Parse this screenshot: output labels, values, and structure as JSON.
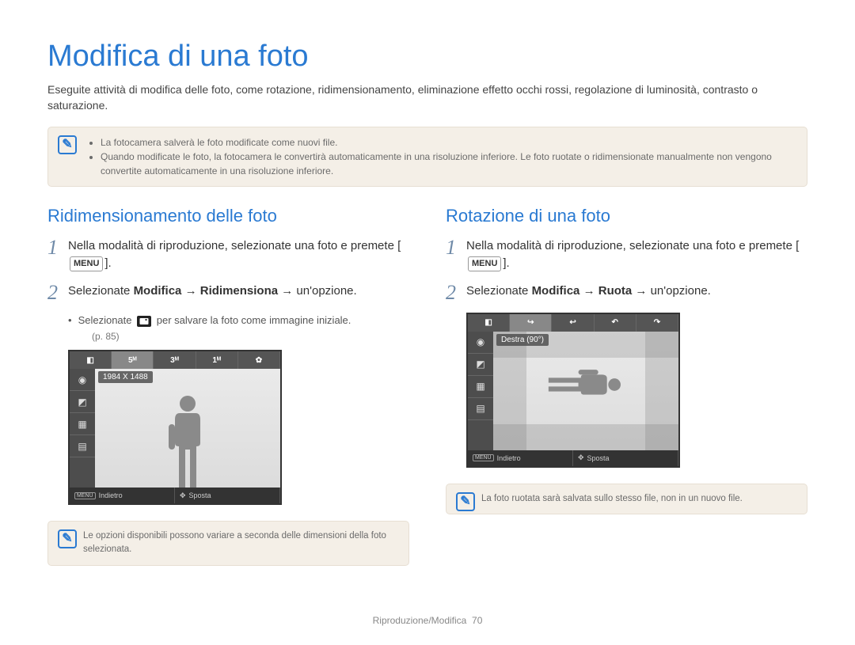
{
  "page": {
    "title": "Modifica di una foto",
    "intro": "Eseguite attività di modifica delle foto, come rotazione, ridimensionamento, eliminazione effetto occhi rossi, regolazione di luminosità, contrasto o saturazione.",
    "footer_section": "Riproduzione/Modifica",
    "footer_page": "70"
  },
  "top_note": {
    "items": [
      "La fotocamera salverà le foto modificate come nuovi file.",
      "Quando modificate le foto, la fotocamera le convertirà automaticamente in una risoluzione inferiore. Le foto ruotate o ridimensionate manualmente non vengono convertite automaticamente in una risoluzione inferiore."
    ]
  },
  "left": {
    "heading": "Ridimensionamento delle foto",
    "step1_a": "Nella modalità di riproduzione, selezionate una foto e premete [",
    "menu_label": "MENU",
    "step1_b": "].",
    "step2_a": "Selezionate ",
    "step2_bold": "Modifica → Ridimensiona",
    "step2_b": " → un'opzione.",
    "substep_a": "Selezionate ",
    "substep_b": " per salvare la foto come immagine iniziale.",
    "page_ref": "(p. 85)",
    "lcd": {
      "top_tabs": [
        "◧",
        "5ᴹ",
        "3ᴹ",
        "1ᴹ",
        "✿"
      ],
      "label": "1984 X 1488",
      "side": [
        "◉",
        "◩",
        "▦",
        "▤"
      ],
      "bottom_back_btn": "MENU",
      "bottom_back": "Indietro",
      "bottom_move_icon": "✥",
      "bottom_move": "Sposta"
    },
    "note": "Le opzioni disponibili possono variare a seconda delle dimensioni della foto selezionata."
  },
  "right": {
    "heading": "Rotazione di una foto",
    "step1_a": "Nella modalità di riproduzione, selezionate una foto e premete [",
    "menu_label": "MENU",
    "step1_b": "].",
    "step2_a": "Selezionate ",
    "step2_bold": "Modifica → Ruota",
    "step2_b": " → un'opzione.",
    "lcd": {
      "top_tabs": [
        "◧",
        "↪",
        "↩",
        "↶",
        "↷"
      ],
      "label": "Destra (90°)",
      "side": [
        "◉",
        "◩",
        "▦",
        "▤"
      ],
      "bottom_back_btn": "MENU",
      "bottom_back": "Indietro",
      "bottom_move_icon": "✥",
      "bottom_move": "Sposta"
    },
    "note": "La foto ruotata sarà salvata sullo stesso file, non in un nuovo file."
  }
}
